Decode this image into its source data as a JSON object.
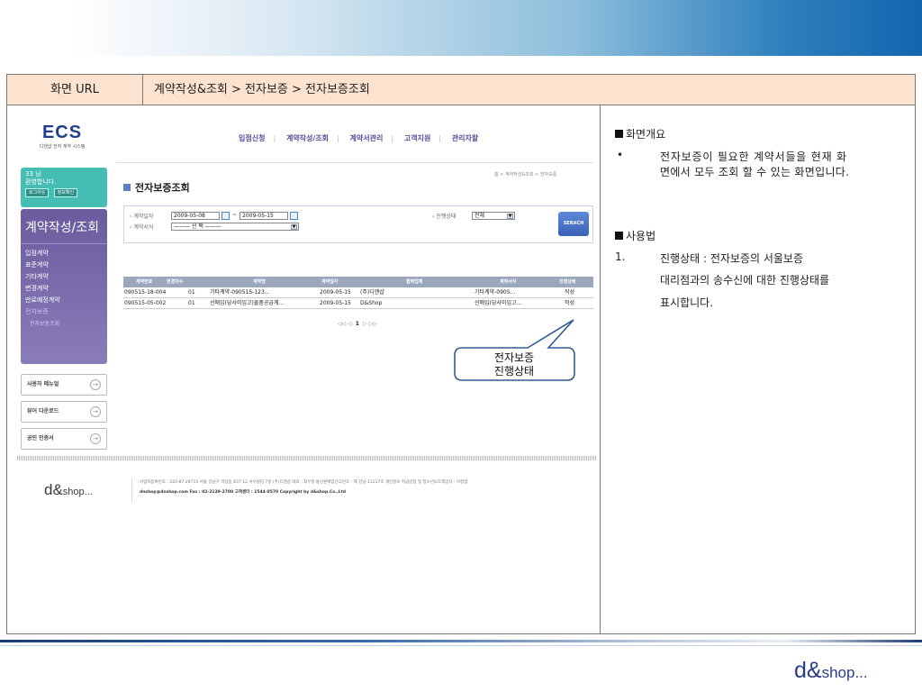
{
  "header": {
    "url_label": "화면 URL",
    "url_path": "계약작성&조회 > 전자보증 > 전자보증조회"
  },
  "app": {
    "logo_big": "ECS",
    "logo_small": "디앤샵 전자 계약 시스템",
    "gnb": [
      "입점신청",
      "계약작성/조회",
      "계약서관리",
      "고객지원",
      "관리자할"
    ],
    "welcome": {
      "user": "33 님",
      "greeting": "환영합니다.",
      "logout": "로그아웃",
      "info": "정보확인"
    },
    "sidebar": {
      "title": "계약작성/조회",
      "items": [
        "입점계약",
        "표준계약",
        "기타계약",
        "변경계약",
        "만료예정계약",
        "전자보증"
      ],
      "subitems": [
        "전자보증조회"
      ]
    },
    "side_boxes": [
      "사용자 메뉴얼",
      "뷰어 다운로드",
      "공인 인증서"
    ],
    "page_title": "전자보증조회",
    "breadcrumb": "홈 > 계약작성&조회 > 전자보증",
    "search": {
      "date_label": "계약일자",
      "date_from": "2009-05-08",
      "date_sep": "~",
      "date_to": "2009-05-15",
      "form_label": "계약서식",
      "form_value": "——— 선 택 ———",
      "status_label": "진행상태",
      "status_value": "전체",
      "button": "SERACH"
    },
    "table": {
      "headers": [
        "계약번호",
        "변경차수",
        "계약명",
        "계약일자",
        "협력업체",
        "계약서식",
        "진행상태"
      ],
      "rows": [
        [
          "090515-18-004",
          "01",
          "기타계약-090515-123...",
          "2009-05-15",
          "(주)디앤샵",
          "기타계약-0905...",
          "작성"
        ],
        [
          "090515-05-002",
          "01",
          "선매입(당사미입고)물품공급계...",
          "2009-05-15",
          "D&Shop",
          "선매입(당사미입고...",
          "작성"
        ]
      ]
    },
    "pager": {
      "prev": "◁◁ ◁",
      "current": "1",
      "next": "▷ ▷▷"
    },
    "footer": {
      "logo": "d&",
      "logo_tail": "shop...",
      "line1": "사업자등록번호 : 220-87-28715  서울 강남구 역삼동 837-12 서우빌딩 7층 (주)디앤샵  대표 : 최우정 통신판매업신고번호 : 제 강남-11217호 개인정보 취급방침 및 청소년보호책임자 : 이정엽",
      "line2": "dnshop@dnshop.com Fax : 02-2139-2700 고객센터 : 1544-0570 Copyright by d&shop.Co.,Ltd"
    }
  },
  "callout": {
    "line1": "전자보증",
    "line2": "진행상태"
  },
  "description": {
    "overview_title": "화면개요",
    "overview_bullet": "•",
    "overview_line1": "전자보증이 필요한 계약서들을 현재 화",
    "overview_line2": "면에서 모두 조회 할 수 있는 화면입니다.",
    "usage_title": "사용법",
    "usage_num": "1.",
    "usage_line1": "진행상태 : 전자보증의 서울보증",
    "usage_line2": "대리점과의 송수신에 대한 진행상태를",
    "usage_line3": "표시합니다."
  },
  "brand": {
    "main": "d&",
    "tail": "shop..."
  }
}
